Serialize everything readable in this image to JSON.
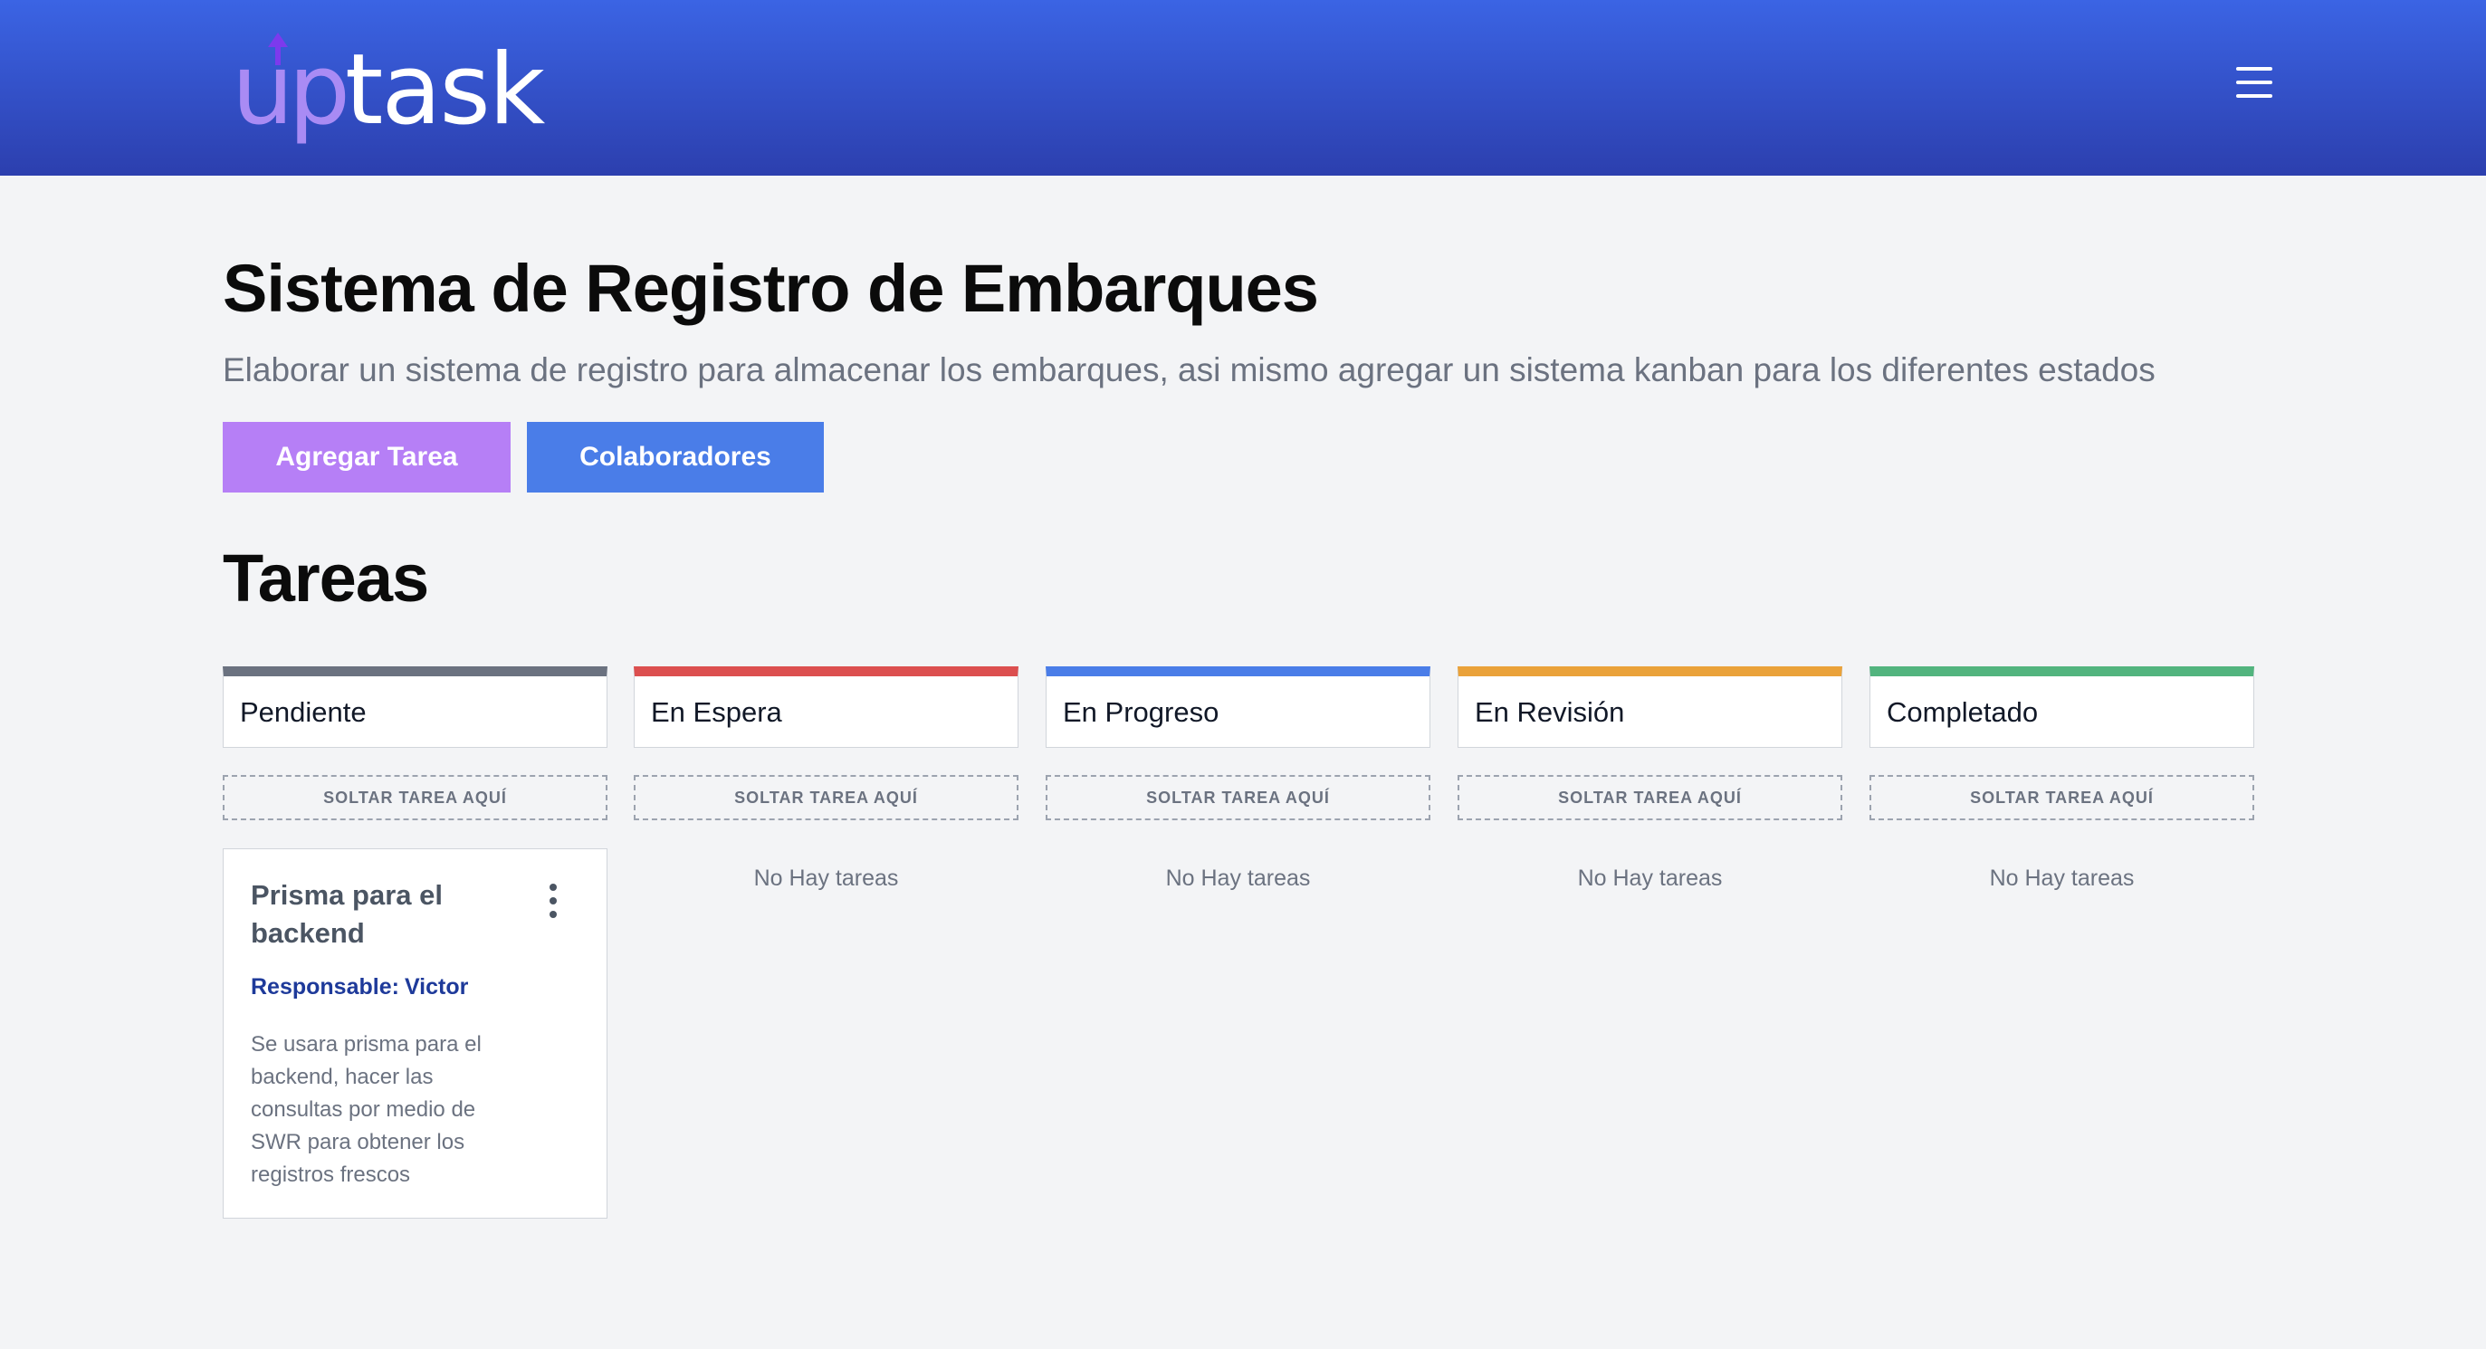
{
  "header": {
    "logo_up": "up",
    "logo_task": "task",
    "menu_icon": "hamburger-icon",
    "gradient_top": "#3b64e4",
    "gradient_bottom": "#2c3fae"
  },
  "project": {
    "title": "Sistema de Registro de Embarques",
    "description": "Elaborar un sistema de registro para almacenar los embarques, asi mismo agregar un sistema kanban para los diferentes estados"
  },
  "actions": {
    "add_task_label": "Agregar Tarea",
    "collaborators_label": "Colaboradores",
    "add_task_color": "#b67ff6",
    "collaborators_color": "#4a7de8"
  },
  "tasks_section": {
    "title": "Tareas"
  },
  "columns": [
    {
      "label": "Pendiente",
      "color": "#6b7280",
      "drop_label": "Soltar tarea aquí",
      "empty_label": ""
    },
    {
      "label": "En Espera",
      "color": "#dc4f4f",
      "drop_label": "Soltar tarea aquí",
      "empty_label": "No Hay tareas"
    },
    {
      "label": "En Progreso",
      "color": "#4a7de8",
      "drop_label": "Soltar tarea aquí",
      "empty_label": "No Hay tareas"
    },
    {
      "label": "En Revisión",
      "color": "#eaa23a",
      "drop_label": "Soltar tarea aquí",
      "empty_label": "No Hay tareas"
    },
    {
      "label": "Completado",
      "color": "#52b47e",
      "drop_label": "Soltar tarea aquí",
      "empty_label": "No Hay tareas"
    }
  ],
  "task": {
    "title": "Prisma para el backend",
    "responsible_label": "Responsable:",
    "responsible_name": "Victor",
    "description": "Se usara prisma para el backend, hacer las consultas por medio de SWR para obtener los registros frescos",
    "menu_icon": "kebab-menu-icon"
  }
}
